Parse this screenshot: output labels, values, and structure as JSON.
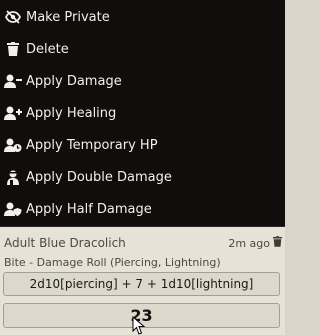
{
  "menu": {
    "items": [
      {
        "label": "Make Private",
        "icon": "eye-slash-icon"
      },
      {
        "label": "Delete",
        "icon": "trash-icon"
      },
      {
        "label": "Apply Damage",
        "icon": "user-minus-icon"
      },
      {
        "label": "Apply Healing",
        "icon": "user-plus-icon"
      },
      {
        "label": "Apply Temporary HP",
        "icon": "user-clock-icon"
      },
      {
        "label": "Apply Double Damage",
        "icon": "user-injured-icon"
      },
      {
        "label": "Apply Half Damage",
        "icon": "user-shield-icon"
      }
    ]
  },
  "message": {
    "speaker": "Adult Blue Dracolich",
    "timestamp": "2m ago",
    "flavor": "Bite - Damage Roll (Piercing, Lightning)",
    "formula": "2d10[piercing] + 7 + 1d10[lightning]",
    "total": "23"
  },
  "colors": {
    "menu_bg": "#0f0e0c",
    "menu_text": "#f2f0ea",
    "card_bg": "#e6e2d6"
  }
}
